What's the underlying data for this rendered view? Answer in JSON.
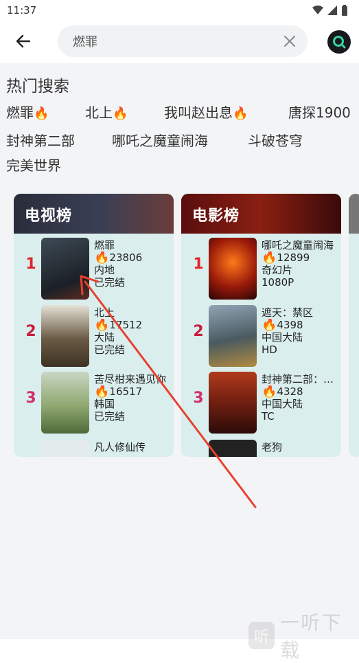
{
  "status": {
    "time": "11:37"
  },
  "search": {
    "value": "燃罪"
  },
  "hot": {
    "title": "热门搜索",
    "tags": [
      {
        "label": "燃罪",
        "fire": true
      },
      {
        "label": "北上",
        "fire": true
      },
      {
        "label": "我叫赵出息",
        "fire": true
      },
      {
        "label": "唐探1900",
        "fire": false
      },
      {
        "label": "封神第二部",
        "fire": false
      },
      {
        "label": "哪吒之魔童闹海",
        "fire": false
      },
      {
        "label": "斗破苍穹",
        "fire": false
      },
      {
        "label": "完美世界",
        "fire": false
      }
    ]
  },
  "tv": {
    "title": "电视榜",
    "items": [
      {
        "rank": "1",
        "name": "燃罪",
        "heat": "23806",
        "region": "内地",
        "status": "已完结"
      },
      {
        "rank": "2",
        "name": "北上",
        "heat": "17512",
        "region": "大陆",
        "status": "已完结"
      },
      {
        "rank": "3",
        "name": "苦尽柑来遇见你",
        "heat": "16517",
        "region": "韩国",
        "status": "已完结"
      },
      {
        "name": "凡人修仙传"
      }
    ]
  },
  "movie": {
    "title": "电影榜",
    "items": [
      {
        "rank": "1",
        "name": "哪吒之魔童闹海",
        "heat": "12899",
        "region": "奇幻片",
        "status": "1080P"
      },
      {
        "rank": "2",
        "name": "遮天：禁区",
        "heat": "4398",
        "region": "中国大陆",
        "status": "HD"
      },
      {
        "rank": "3",
        "name": "封神第二部：战火西岐",
        "heat": "4328",
        "region": "中国大陆",
        "status": "TC"
      },
      {
        "name": "老狗"
      }
    ]
  },
  "watermark": {
    "logo": "听",
    "text": "一听下载"
  },
  "colors": {
    "rank1": "#e0262b",
    "rank2": "#c81d3e",
    "rank3": "#d0306a",
    "fire": "#ff5a1a",
    "card_bg": "#dbeeee"
  }
}
